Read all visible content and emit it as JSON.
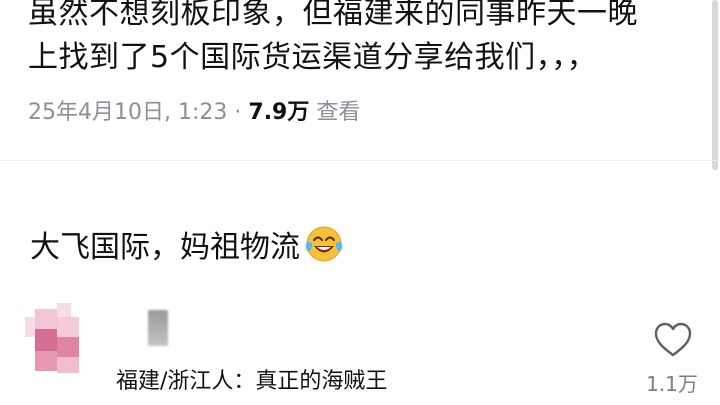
{
  "post": {
    "line1": "虽然不想刻板印象，但福建来的同事昨天一晚",
    "line2": "上找到了5个国际货运渠道分享给我们，，，",
    "date": "25年4月10日, 1:23",
    "separator": "·",
    "views": "7.9万",
    "views_label": "查看"
  },
  "reply": {
    "text": "大飞国际，妈祖物流",
    "emoji": "face-with-tears-of-joy"
  },
  "comment": {
    "text": "福建/浙江人：真正的海贼王",
    "likes": "1.1万"
  },
  "colors": {
    "meta_gray": "#8a8f99",
    "avatar_pink_dark": "#d56f93",
    "avatar_pink_light": "#f2c6d6"
  }
}
